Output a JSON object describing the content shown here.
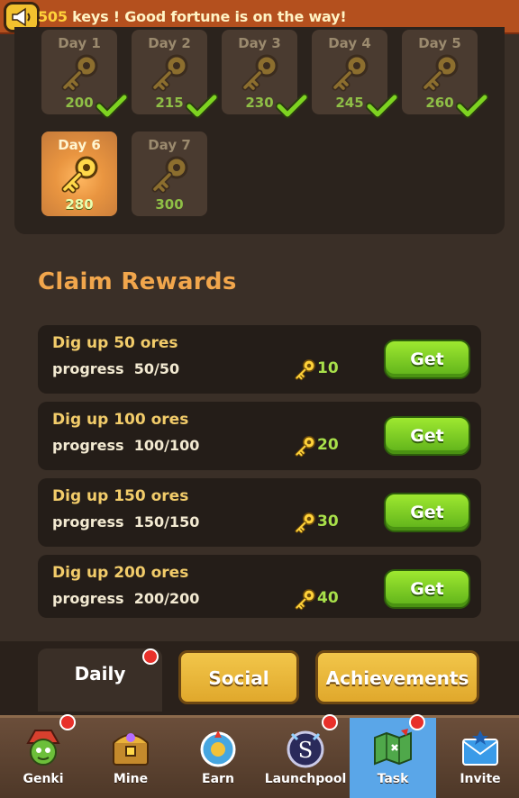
{
  "ticker": {
    "count": "505",
    "message": " keys ! Good fortune is on the way!"
  },
  "login_days": [
    {
      "label": "Day 1",
      "amount": "200",
      "claimed": true,
      "active": false
    },
    {
      "label": "Day 2",
      "amount": "215",
      "claimed": true,
      "active": false
    },
    {
      "label": "Day 3",
      "amount": "230",
      "claimed": true,
      "active": false
    },
    {
      "label": "Day 4",
      "amount": "245",
      "claimed": true,
      "active": false
    },
    {
      "label": "Day 5",
      "amount": "260",
      "claimed": true,
      "active": false
    },
    {
      "label": "Day 6",
      "amount": "280",
      "claimed": false,
      "active": true
    },
    {
      "label": "Day 7",
      "amount": "300",
      "claimed": false,
      "active": false
    }
  ],
  "claim": {
    "title": "Claim Rewards",
    "rewards": [
      {
        "title": "Dig up 50 ores",
        "progress": "progress  50/50",
        "amount": "10",
        "button": "Get"
      },
      {
        "title": "Dig up 100 ores",
        "progress": "progress  100/100",
        "amount": "20",
        "button": "Get"
      },
      {
        "title": "Dig up 150 ores",
        "progress": "progress  150/150",
        "amount": "30",
        "button": "Get"
      },
      {
        "title": "Dig up 200 ores",
        "progress": "progress  200/200",
        "amount": "40",
        "button": "Get"
      }
    ]
  },
  "tabs": {
    "daily": "Daily",
    "social": "Social",
    "achievements": "Achievements"
  },
  "nav": [
    {
      "label": "Genki",
      "icon": "goblin-icon",
      "badge": true
    },
    {
      "label": "Mine",
      "icon": "treasure-chest-icon",
      "badge": false
    },
    {
      "label": "Earn",
      "icon": "compass-icon",
      "badge": false
    },
    {
      "label": "Launchpool",
      "icon": "s-coin-icon",
      "badge": true
    },
    {
      "label": "Task",
      "icon": "map-icon",
      "badge": true,
      "active": true
    },
    {
      "label": "Invite",
      "icon": "envelope-icon",
      "badge": false
    }
  ],
  "colors": {
    "background": "#3a2f27",
    "accent_orange": "#f1a64c",
    "button_green": "#7fd024",
    "nav_active": "#5aa6e8"
  }
}
